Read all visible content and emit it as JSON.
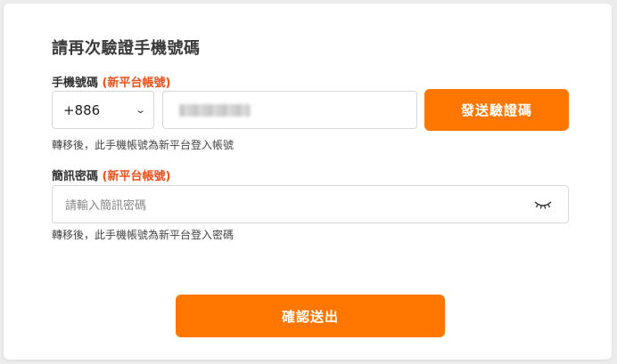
{
  "form": {
    "title": "請再次驗證手機號碼",
    "phone_label": "手機號碼",
    "phone_label_accent": "(新平台帳號)",
    "country_code": "+886",
    "send_code_button": "發送驗證碼",
    "phone_hint": "轉移後，此手機帳號為新平台登入帳號",
    "sms_label": "簡訊密碼",
    "sms_label_accent": "(新平台帳號)",
    "sms_placeholder": "請輸入簡訊密碼",
    "sms_hint": "轉移後，此手機帳號為新平台登入密碼",
    "submit_button": "確認送出"
  },
  "icons": {
    "dropdown": "chevron-down-icon",
    "visibility": "eye-closed-icon"
  },
  "colors": {
    "accent": "#ff7700",
    "label_accent": "#e8521f"
  }
}
